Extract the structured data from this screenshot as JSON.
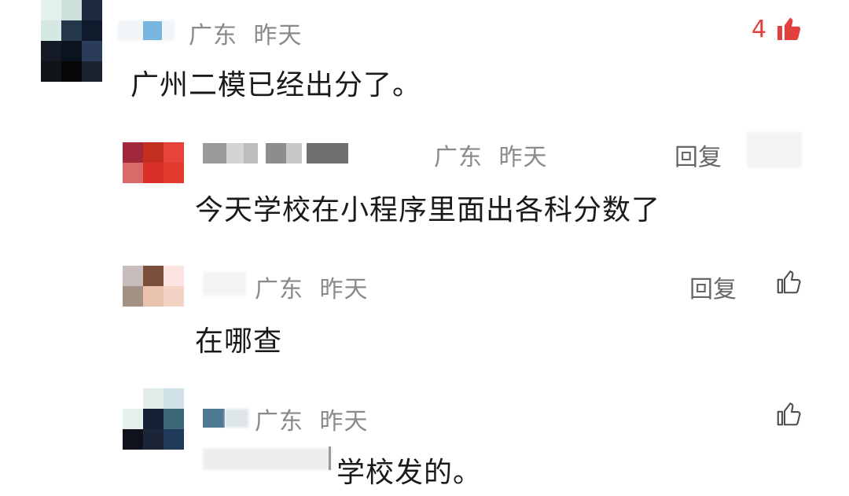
{
  "colors": {
    "like_active": "#e0413f",
    "meta_text": "#8a8a8a",
    "body_text": "#1a1a1a"
  },
  "comments": [
    {
      "location": "广东",
      "time": "昨天",
      "text": "广州二模已经出分了。",
      "likes": "4",
      "like_icon": "thumbs-up-filled-icon"
    }
  ],
  "replies": [
    {
      "location": "广东",
      "time": "昨天",
      "text": "今天学校在小程序里面出各科分数了",
      "reply_label": "回复"
    },
    {
      "location": "广东",
      "time": "昨天",
      "text": "在哪查",
      "reply_label": "回复",
      "like_icon": "thumbs-up-outline-icon"
    },
    {
      "location": "广东",
      "time": "昨天",
      "text": "学校发的。",
      "like_icon": "thumbs-up-outline-icon"
    }
  ]
}
